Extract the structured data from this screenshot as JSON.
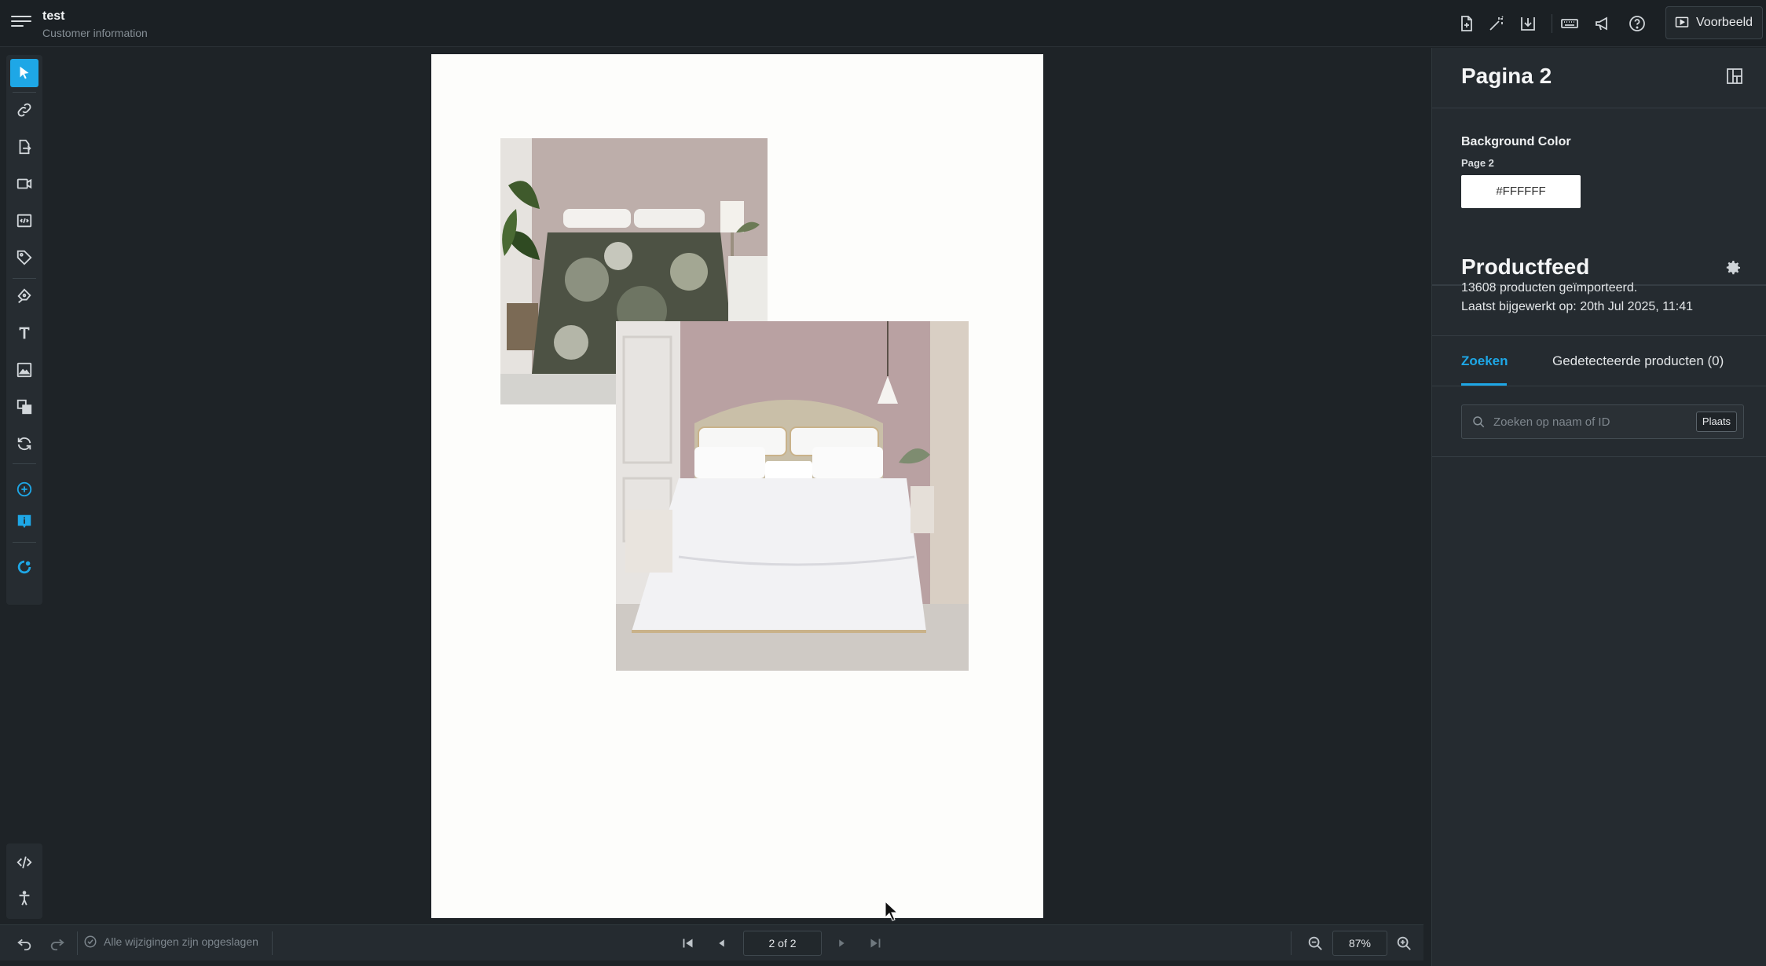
{
  "header": {
    "doc_title": "test",
    "doc_subtitle": "Customer information",
    "icons": [
      "add-page-icon",
      "magic-wand-icon",
      "download-icon",
      "keyboard-icon",
      "megaphone-icon",
      "help-icon"
    ],
    "preview_label": "Voorbeeld"
  },
  "left_toolbar": {
    "tools": [
      "select-pointer-icon",
      "link-icon",
      "export-icon",
      "video-icon",
      "embed-code-icon",
      "tag-icon",
      "pen-tool-icon",
      "text-icon",
      "image-icon",
      "layers-icon",
      "refresh-icon",
      "add-circle-icon",
      "info-badge-icon",
      "shop-integration-icon"
    ],
    "bottom_tools": [
      "code-icon",
      "accessibility-icon"
    ]
  },
  "right_panel": {
    "page_title": "Pagina 2",
    "background_color_label": "Background Color",
    "background_color_sub": "Page 2",
    "background_color_value": "#FFFFFF",
    "productfeed_title": "Productfeed",
    "productfeed_imported": "13608 producten geïmporteerd.",
    "productfeed_updated": "Laatst bijgewerkt op: 20th Jul 2025, 11:41",
    "tabs": [
      {
        "label": "Zoeken",
        "active": true
      },
      {
        "label": "Gedetecteerde producten (0)",
        "active": false
      }
    ],
    "search_placeholder": "Zoeken op naam of ID",
    "place_button": "Plaats"
  },
  "bottom_bar": {
    "saved_status": "Alle wijzigingen zijn opgeslagen",
    "page_indicator": "2 of 2",
    "zoom": "87%"
  },
  "colors": {
    "accent": "#1ea7e6",
    "background": "#1e2327",
    "panel": "#252b30",
    "page": "#fdfdfb"
  }
}
